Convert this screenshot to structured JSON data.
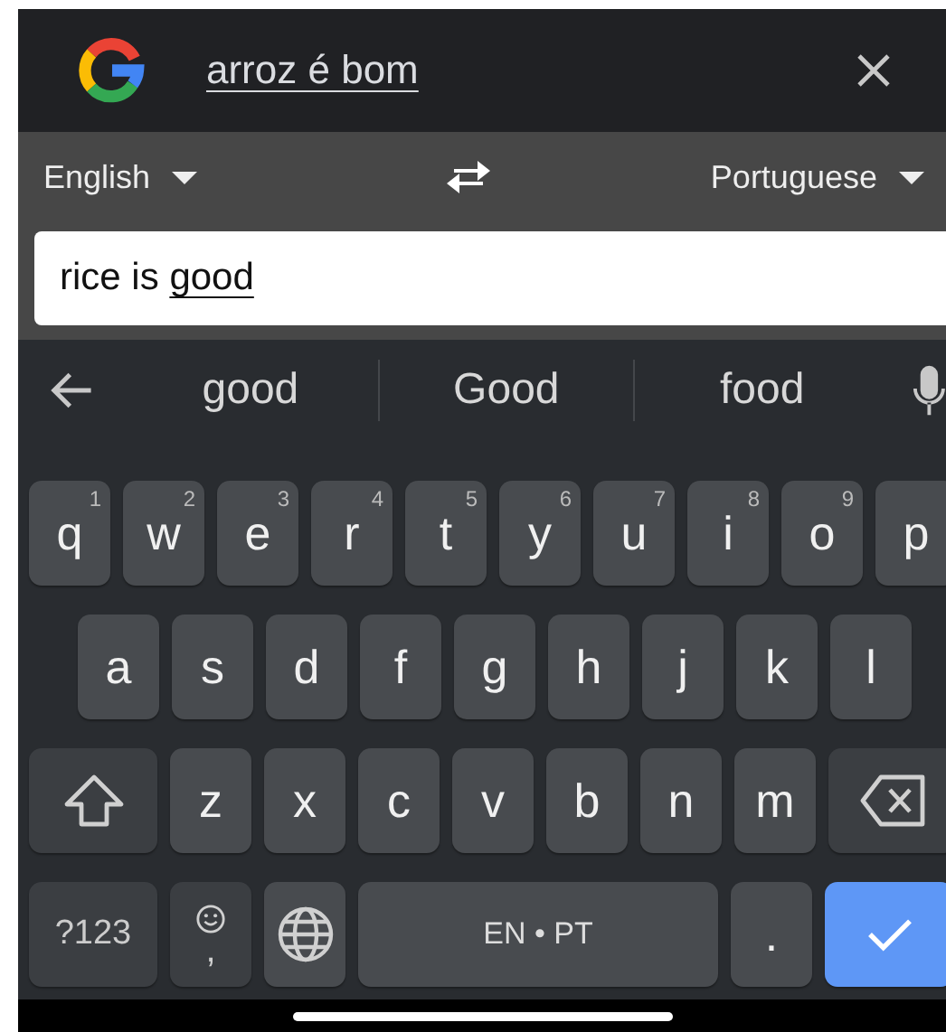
{
  "header": {
    "translation": "arroz é bom"
  },
  "languages": {
    "source": "English",
    "target": "Portuguese"
  },
  "input": {
    "committed": "rice is",
    "composing": "good"
  },
  "suggestions": [
    "good",
    "Good",
    "food"
  ],
  "keyboard": {
    "number_row": [
      {
        "kind": "letter",
        "label": "q",
        "hint": "1"
      },
      {
        "kind": "letter",
        "label": "w",
        "hint": "2"
      },
      {
        "kind": "letter",
        "label": "e",
        "hint": "3"
      },
      {
        "kind": "letter",
        "label": "r",
        "hint": "4"
      },
      {
        "kind": "letter",
        "label": "t",
        "hint": "5"
      },
      {
        "kind": "letter",
        "label": "y",
        "hint": "6"
      },
      {
        "kind": "letter",
        "label": "u",
        "hint": "7"
      },
      {
        "kind": "letter",
        "label": "i",
        "hint": "8"
      },
      {
        "kind": "letter",
        "label": "o",
        "hint": "9"
      },
      {
        "kind": "letter",
        "label": "p"
      }
    ],
    "home_row": [
      {
        "kind": "letter",
        "label": "a"
      },
      {
        "kind": "letter",
        "label": "s"
      },
      {
        "kind": "letter",
        "label": "d"
      },
      {
        "kind": "letter",
        "label": "f"
      },
      {
        "kind": "letter",
        "label": "g"
      },
      {
        "kind": "letter",
        "label": "h"
      },
      {
        "kind": "letter",
        "label": "j"
      },
      {
        "kind": "letter",
        "label": "k"
      },
      {
        "kind": "letter",
        "label": "l"
      }
    ],
    "shift_row": [
      {
        "kind": "shift"
      },
      {
        "kind": "letter",
        "label": "z"
      },
      {
        "kind": "letter",
        "label": "x"
      },
      {
        "kind": "letter",
        "label": "c"
      },
      {
        "kind": "letter",
        "label": "v"
      },
      {
        "kind": "letter",
        "label": "b"
      },
      {
        "kind": "letter",
        "label": "n"
      },
      {
        "kind": "letter",
        "label": "m"
      },
      {
        "kind": "backspace"
      }
    ],
    "function_row": [
      {
        "kind": "symbols",
        "label": "?123"
      },
      {
        "kind": "emoji",
        "label": ","
      },
      {
        "kind": "globe"
      },
      {
        "kind": "space",
        "label": "EN • PT"
      },
      {
        "kind": "letter",
        "label": "."
      },
      {
        "kind": "enter"
      }
    ]
  }
}
